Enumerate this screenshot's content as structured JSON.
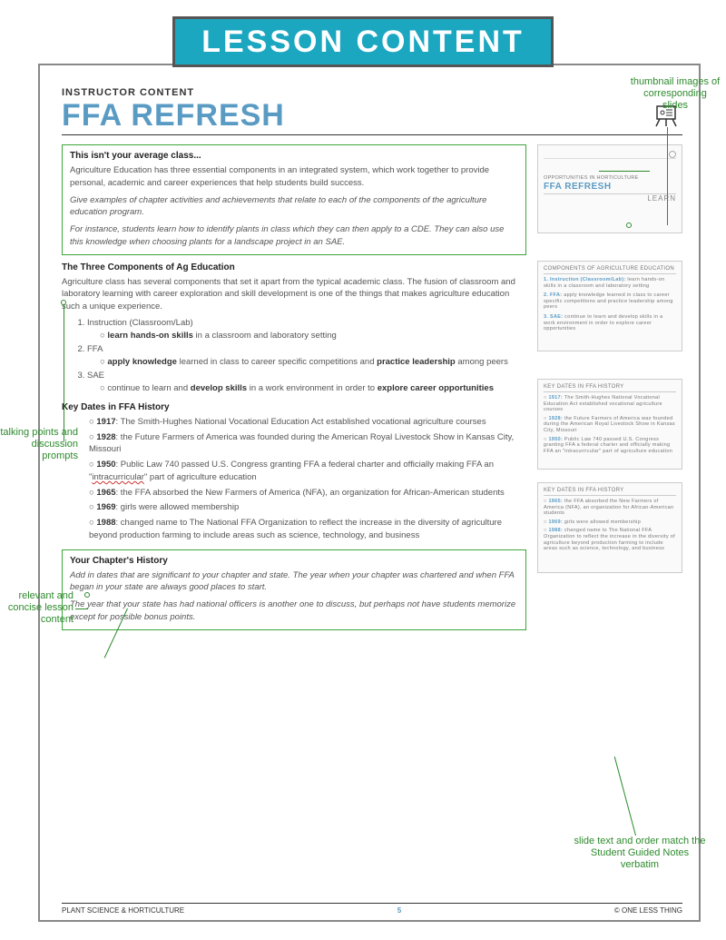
{
  "banner": "LESSON CONTENT",
  "overline": "INSTRUCTOR CONTENT",
  "main_title": "FFA REFRESH",
  "intro": {
    "title": "This isn't your average class...",
    "p1": "Agriculture Education has three essential components in an integrated system, which work together to provide personal, academic and career experiences that help students build success.",
    "p2": "Give examples of chapter activities and achievements that relate to each of the components of the agriculture education program.",
    "p3": "For instance, students learn how to identify plants in class which they can then apply to a CDE. They can also use this knowledge when choosing plants for a landscape project in an SAE."
  },
  "components": {
    "title": "The Three Components of Ag Education",
    "lead": "Agriculture class has several components that set it apart from the typical academic class. The fusion of classroom and laboratory learning with career exploration and skill development is one of the things that makes agriculture education such a unique experience.",
    "items": [
      {
        "name": "Instruction (Classroom/Lab)",
        "bullet_pre": "learn hands-on skills",
        "bullet_post": " in a classroom and laboratory setting"
      },
      {
        "name": "FFA",
        "bullet_pre": "apply knowledge",
        "bullet_mid": " learned in class to career specific competitions and ",
        "bullet_pre2": "practice leadership",
        "bullet_post": " among peers"
      },
      {
        "name": "SAE",
        "bullet_text": "continue to learn and ",
        "bullet_pre": "develop skills",
        "bullet_mid": " in a work environment in order to ",
        "bullet_pre2": "explore career opportunities"
      }
    ]
  },
  "dates": {
    "title": "Key Dates in FFA History",
    "items": [
      {
        "year": "1917",
        "text": ": The Smith-Hughes National Vocational Education Act established vocational agriculture courses"
      },
      {
        "year": "1928",
        "text": ": the Future Farmers of America was founded during the American Royal Livestock Show in Kansas City, Missouri"
      },
      {
        "year": "1950",
        "text_a": ": Public Law 740 passed U.S. Congress granting FFA a federal charter and officially making FFA an \"",
        "wavy": "intracurricular",
        "text_b": "\" part of agriculture education"
      },
      {
        "year": "1965",
        "text": ": the FFA absorbed the New Farmers of America (NFA), an organization for African-American students"
      },
      {
        "year": "1969",
        "text": ": girls were allowed membership"
      },
      {
        "year": "1988",
        "text": ": changed name to The National FFA Organization to reflect the increase in the diversity of agriculture beyond production farming to include areas such as science, technology, and business"
      }
    ]
  },
  "chapter": {
    "title": "Your Chapter's History",
    "p1": "Add in dates that are significant to your chapter and state. The year when your chapter was chartered and when FFA began in your state are always good places to start.",
    "p2": "The year that your state has had national officers is another one to discuss, but perhaps not have students memorize except for possible bonus points."
  },
  "thumbs": {
    "t1": {
      "overline": "OPPORTUNITIES IN HORTICULTURE",
      "title": "FFA REFRESH",
      "sub": "LEARN"
    },
    "t2": {
      "head": "COMPONENTS OF AGRICULTURE EDUCATION",
      "l1a": "1.",
      "l1b": "Instruction (Classroom/Lab):",
      "l1c": " learn hands-on skills in a classroom and laboratory setting",
      "l2a": "2.",
      "l2b": "FFA:",
      "l2c": " apply knowledge learned in class to career specific competitions and practice leadership among peers",
      "l3a": "3.",
      "l3b": "SAE:",
      "l3c": " continue to learn and develop skills in a work environment in order to explore career opportunities"
    },
    "t3": {
      "head": "KEY DATES IN FFA HISTORY",
      "l1a": "○",
      "l1b": "1917:",
      "l1c": " The Smith-Hughes National Vocational Education Act established vocational agriculture courses",
      "l2a": "○",
      "l2b": "1928:",
      "l2c": " the Future Farmers of America was founded during the American Royal Livestock Show in Kansas City, Missouri",
      "l3a": "○",
      "l3b": "1950:",
      "l3c": " Public Law 740 passed U.S. Congress granting FFA a federal charter and officially making FFA an \"intracurricular\" part of agriculture education"
    },
    "t4": {
      "head": "KEY DATES IN FFA HISTORY",
      "l1a": "○",
      "l1b": "1965:",
      "l1c": " the FFA absorbed the New Farmers of America (NFA), an organization for African-American students",
      "l2a": "○",
      "l2b": "1969:",
      "l2c": " girls were allowed membership",
      "l3a": "○",
      "l3b": "1988:",
      "l3c": " changed name to The National FFA Organization to reflect the increase in the diversity of agriculture beyond production farming to include areas such as science, technology, and business"
    }
  },
  "footer": {
    "left": "PLANT SCIENCE & HORTICULTURE",
    "page": "5",
    "right": "© ONE LESS THING"
  },
  "callouts": {
    "c1": "thumbnail images of corresponding slides",
    "c2": "talking points and discussion prompts",
    "c3": "relevant and concise lesson content",
    "c4": "slide text and order match the Student Guided Notes verbatim"
  }
}
